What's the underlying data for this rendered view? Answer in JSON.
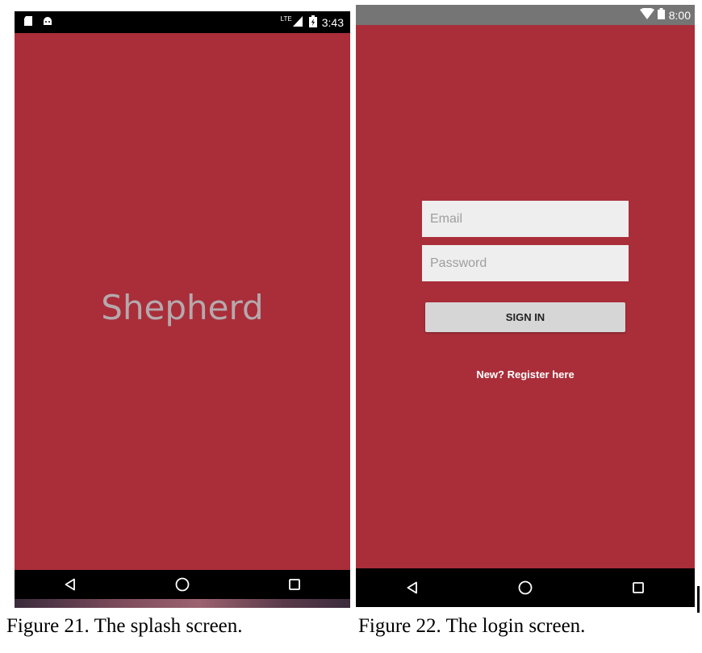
{
  "splash": {
    "status_time": "3:43",
    "network_label": "LTE",
    "title": "Shepherd",
    "caption": "Figure 21. The splash screen."
  },
  "login": {
    "status_time": "8:00",
    "email_placeholder": "Email",
    "password_placeholder": "Password",
    "sign_in_label": "SIGN IN",
    "register_link": "New? Register here",
    "caption": "Figure 22. The login screen."
  },
  "colors": {
    "app_background": "#a92e39",
    "status_bar_splash": "#000000",
    "status_bar_login": "#757575",
    "nav_bar": "#000000",
    "input_background": "#eeeeee",
    "button_background": "#d6d6d6",
    "splash_title": "#b5a9ad"
  },
  "icons": {
    "splash_status_left": [
      "sd-card-icon",
      "android-icon"
    ],
    "splash_status_right": [
      "signal-icon",
      "battery-charging-icon"
    ],
    "login_status_right": [
      "wifi-icon",
      "battery-icon"
    ],
    "nav": [
      "back-icon",
      "home-icon",
      "recents-icon"
    ]
  }
}
